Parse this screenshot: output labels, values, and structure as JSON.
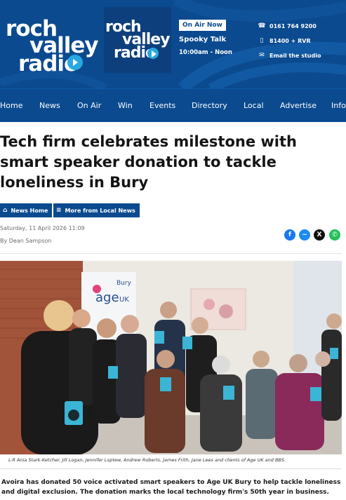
{
  "brand": {
    "logo_text": [
      "roch",
      "valley",
      "radio"
    ],
    "colors": {
      "header_bg": "#0b4a8f",
      "accent": "#29a8e0",
      "nav_bg": "#0b4a8f"
    }
  },
  "on_air": {
    "badge": "On Air Now",
    "show": "Spooky Talk",
    "time": "10:00am - Noon"
  },
  "contacts": [
    {
      "icon": "phone-icon",
      "text": "0161 764 9200"
    },
    {
      "icon": "mobile-icon",
      "text": "81400 + RVR"
    },
    {
      "icon": "mail-icon",
      "text": "Email the studio"
    }
  ],
  "nav": {
    "items": [
      "Home",
      "News",
      "On Air",
      "Win",
      "Events",
      "Directory",
      "Local",
      "Advertise",
      "Info"
    ]
  },
  "article": {
    "title": "Tech firm celebrates milestone with smart speaker donation to tackle loneliness in Bury",
    "buttons": {
      "news_home": "News Home",
      "more_local": "More from Local News"
    },
    "date": "Saturday, 11 April 2026 11:09",
    "author": "By Dean Sampson",
    "share_icons": [
      "facebook-icon",
      "messenger-icon",
      "x-icon",
      "whatsapp-icon"
    ],
    "photo_banner_text": [
      "Bury",
      "age",
      "UK"
    ],
    "caption": "L-R Ania Stark-Ketcher, Jill Logan, Jennifer Loptew, Andrew Roberts, James Frith, Jane Lees and clients of Age UK and BBS.",
    "body": "Avoira has donated 50 voice activated smart speakers to Age UK Bury to help tackle loneliness and digital exclusion. The donation marks the local technology firm's 50th year in business."
  }
}
